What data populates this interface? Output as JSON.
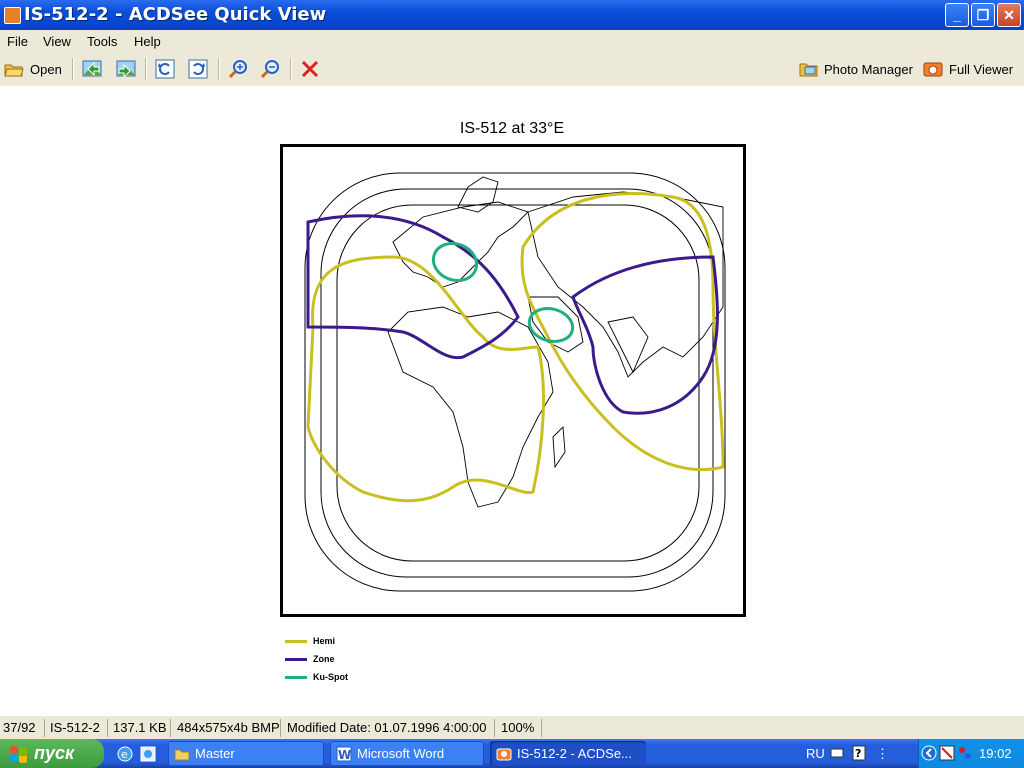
{
  "window": {
    "title": "IS-512-2 - ACDSee Quick View",
    "minimize": "_",
    "maximize": "❐",
    "close": "✕"
  },
  "menu": {
    "items": [
      {
        "label": "File"
      },
      {
        "label": "View"
      },
      {
        "label": "Tools"
      },
      {
        "label": "Help"
      }
    ]
  },
  "toolbar": {
    "open_label": "Open",
    "photo_manager_label": "Photo Manager",
    "full_viewer_label": "Full Viewer",
    "icons": [
      "open-folder-icon",
      "previous-image-icon",
      "next-image-icon",
      "rotate-left-icon",
      "rotate-right-icon",
      "zoom-in-icon",
      "zoom-out-icon",
      "delete-icon",
      "photo-manager-icon",
      "full-viewer-icon"
    ]
  },
  "image": {
    "title": "IS-512 at 33°E",
    "legend": [
      {
        "label": "Hemi",
        "color": "#c8c020"
      },
      {
        "label": "Zone",
        "color": "#3a1a8c"
      },
      {
        "label": "Ku-Spot",
        "color": "#20b080"
      }
    ]
  },
  "status": {
    "index": "37/92",
    "name": "IS-512-2",
    "size": "137.1 KB",
    "format": "484x575x4b BMP",
    "modified": "Modified Date: 01.07.1996 4:00:00",
    "zoom": "100%"
  },
  "taskbar": {
    "start_label": "пуск",
    "tasks": [
      {
        "label": "Master"
      },
      {
        "label": "Microsoft Word"
      },
      {
        "label": "IS-512-2 - ACDSe..."
      }
    ],
    "lang": "RU",
    "time": "19:02"
  }
}
